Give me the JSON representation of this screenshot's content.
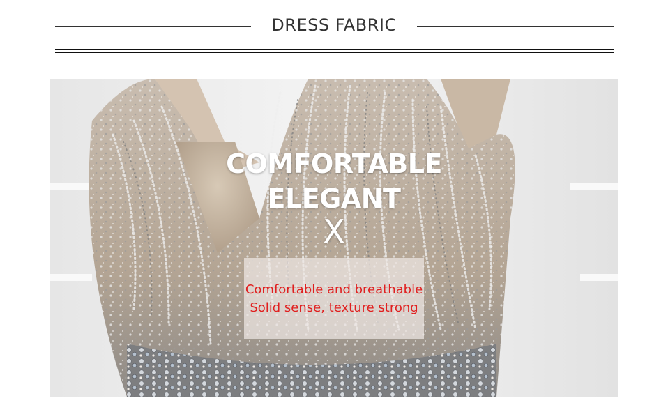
{
  "header": {
    "title": "DRESS FABRIC"
  },
  "photo": {
    "headline_line1": "COMFORTABLE",
    "headline_line2": "ELEGANT",
    "headline_mark": "X",
    "caption_line1": "Comfortable and breathable",
    "caption_line2": "Solid sense, texture strong"
  },
  "colors": {
    "caption_text": "#e02020",
    "headline_text": "#ffffff",
    "fabric_base": "#b9a99a",
    "background_wall": "#f0f0f0"
  }
}
